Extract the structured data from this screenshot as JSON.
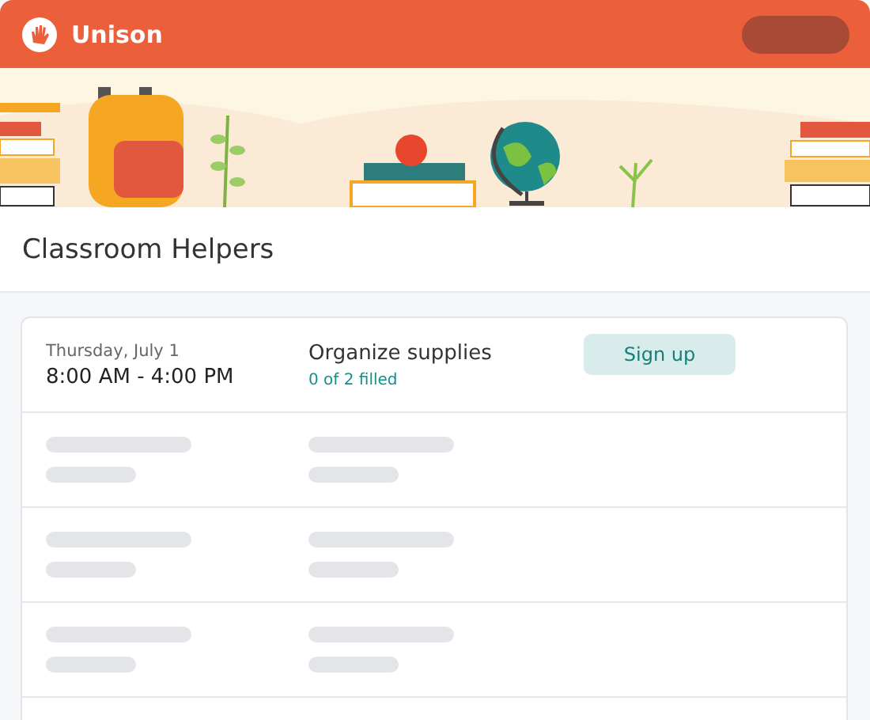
{
  "header": {
    "brand": "Unison"
  },
  "page": {
    "title": "Classroom Helpers"
  },
  "slots": [
    {
      "date": "Thursday, July 1",
      "time": "8:00 AM - 4:00 PM",
      "task": "Organize supplies",
      "filled": "0 of 2 filled",
      "button": "Sign up"
    }
  ]
}
